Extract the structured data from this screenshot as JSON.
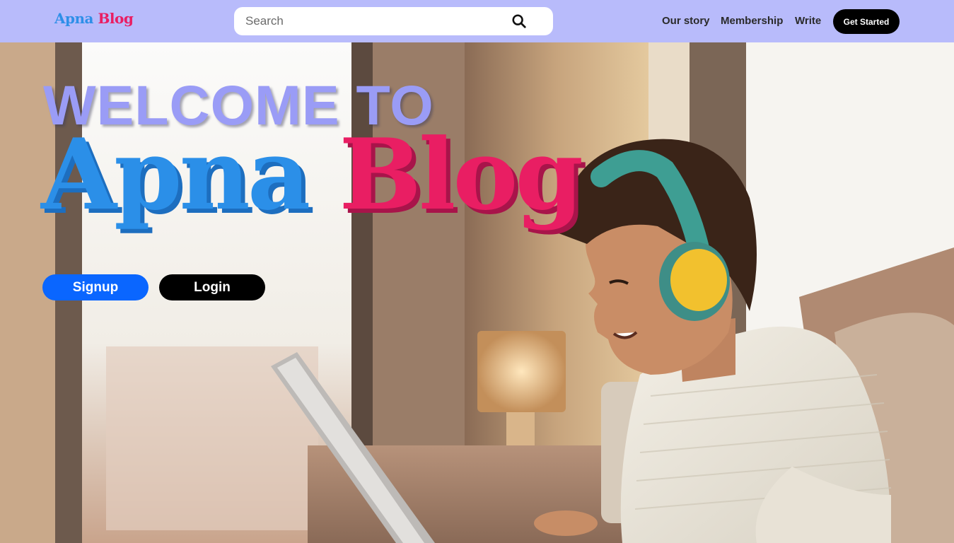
{
  "navbar": {
    "logo_part1": "Apna",
    "logo_part2": "Blog",
    "search_placeholder": "Search",
    "links": [
      "Our story",
      "Membership",
      "Write"
    ],
    "cta_label": "Get Started"
  },
  "hero": {
    "welcome_text": "WELCOME TO",
    "brand_part1": "Apna",
    "brand_part2": "Blog",
    "signup_label": "Signup",
    "login_label": "Login",
    "image_description_icon": "child-with-headphones-laptop-photo"
  },
  "colors": {
    "navbar_bg": "#b8bbfb",
    "brand_blue": "#2b8fe8",
    "brand_pink": "#e91e63",
    "welcome_purple": "#9a9cf6",
    "signup_blue": "#0a66ff",
    "login_black": "#000000"
  }
}
